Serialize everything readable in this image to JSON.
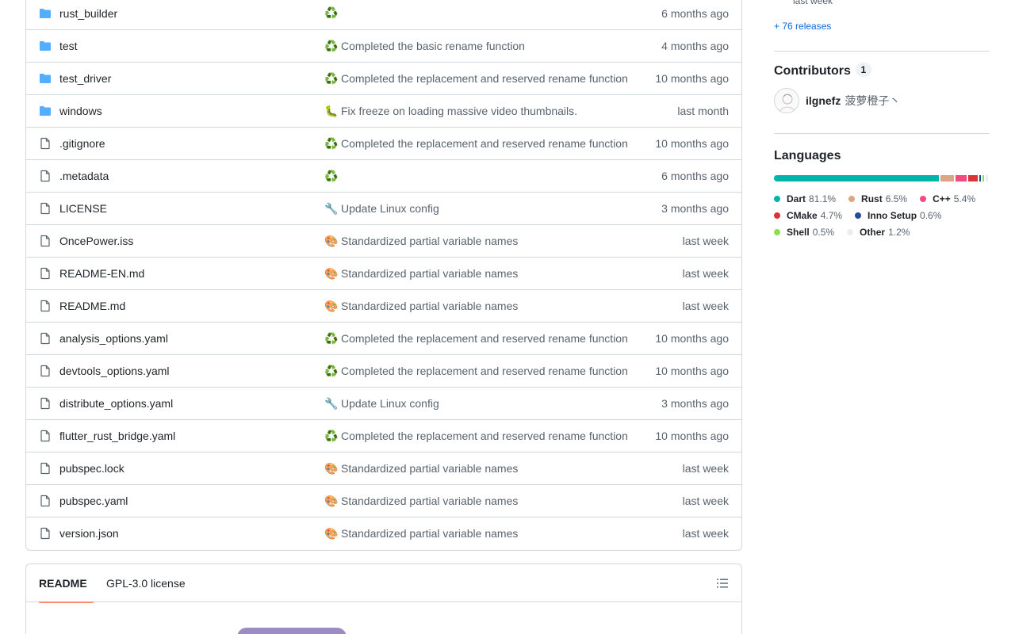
{
  "files": [
    {
      "name": "rust_builder",
      "type": "folder",
      "emoji": "♻️",
      "message": "",
      "age": "6 months ago"
    },
    {
      "name": "test",
      "type": "folder",
      "emoji": "♻️",
      "message": "Completed the basic rename function",
      "age": "4 months ago"
    },
    {
      "name": "test_driver",
      "type": "folder",
      "emoji": "♻️",
      "message": "Completed the replacement and reserved rename function",
      "age": "10 months ago"
    },
    {
      "name": "windows",
      "type": "folder",
      "emoji": "🐛",
      "message": "Fix freeze on loading massive video thumbnails.",
      "age": "last month"
    },
    {
      "name": ".gitignore",
      "type": "file",
      "emoji": "♻️",
      "message": "Completed the replacement and reserved rename function",
      "age": "10 months ago"
    },
    {
      "name": ".metadata",
      "type": "file",
      "emoji": "♻️",
      "message": "",
      "age": "6 months ago"
    },
    {
      "name": "LICENSE",
      "type": "file",
      "emoji": "🔧",
      "message": "Update Linux config",
      "age": "3 months ago"
    },
    {
      "name": "OncePower.iss",
      "type": "file",
      "emoji": "🎨",
      "message": "Standardized partial variable names",
      "age": "last week"
    },
    {
      "name": "README-EN.md",
      "type": "file",
      "emoji": "🎨",
      "message": "Standardized partial variable names",
      "age": "last week"
    },
    {
      "name": "README.md",
      "type": "file",
      "emoji": "🎨",
      "message": "Standardized partial variable names",
      "age": "last week"
    },
    {
      "name": "analysis_options.yaml",
      "type": "file",
      "emoji": "♻️",
      "message": "Completed the replacement and reserved rename function",
      "age": "10 months ago"
    },
    {
      "name": "devtools_options.yaml",
      "type": "file",
      "emoji": "♻️",
      "message": "Completed the replacement and reserved rename function",
      "age": "10 months ago"
    },
    {
      "name": "distribute_options.yaml",
      "type": "file",
      "emoji": "🔧",
      "message": "Update Linux config",
      "age": "3 months ago"
    },
    {
      "name": "flutter_rust_bridge.yaml",
      "type": "file",
      "emoji": "♻️",
      "message": "Completed the replacement and reserved rename function",
      "age": "10 months ago"
    },
    {
      "name": "pubspec.lock",
      "type": "file",
      "emoji": "🎨",
      "message": "Standardized partial variable names",
      "age": "last week"
    },
    {
      "name": "pubspec.yaml",
      "type": "file",
      "emoji": "🎨",
      "message": "Standardized partial variable names",
      "age": "last week"
    },
    {
      "name": "version.json",
      "type": "file",
      "emoji": "🎨",
      "message": "Standardized partial variable names",
      "age": "last week"
    }
  ],
  "readme": {
    "tabs": [
      "README",
      "GPL-3.0 license"
    ],
    "active_tab": "README"
  },
  "sidebar": {
    "latest_release_age": "last week",
    "releases_link": "+ 76 releases",
    "contributors_title": "Contributors",
    "contributors_count": "1",
    "contributor_login": "ilgnefz",
    "contributor_name": "菠萝橙子丶",
    "languages_title": "Languages",
    "languages": [
      {
        "name": "Dart",
        "pct": "81.1%",
        "value": 81.1,
        "color": "#00B4AB"
      },
      {
        "name": "Rust",
        "pct": "6.5%",
        "value": 6.5,
        "color": "#dea584"
      },
      {
        "name": "C++",
        "pct": "5.4%",
        "value": 5.4,
        "color": "#f34b7d"
      },
      {
        "name": "CMake",
        "pct": "4.7%",
        "value": 4.7,
        "color": "#DA3434"
      },
      {
        "name": "Inno Setup",
        "pct": "0.6%",
        "value": 0.6,
        "color": "#264b99"
      },
      {
        "name": "Shell",
        "pct": "0.5%",
        "value": 0.5,
        "color": "#89e051"
      },
      {
        "name": "Other",
        "pct": "1.2%",
        "value": 1.2,
        "color": "#ededed"
      }
    ]
  },
  "colors": {
    "folder_icon": "#54aeff",
    "file_icon": "#59636e",
    "link": "#0969da",
    "tab_underline": "#fd8c73"
  }
}
